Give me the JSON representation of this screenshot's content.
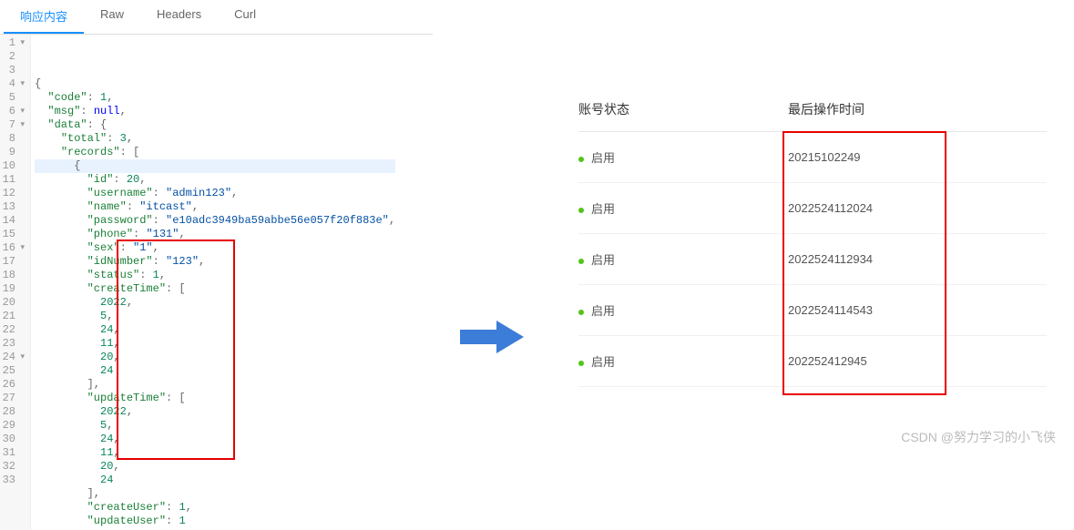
{
  "tabs": {
    "t0": "响应内容",
    "t1": "Raw",
    "t2": "Headers",
    "t3": "Curl"
  },
  "json_content": {
    "code": 1,
    "msg": null,
    "data": {
      "total": 3,
      "records": [
        {
          "id": 20,
          "username": "admin123",
          "name": "itcast",
          "password": "e10adc3949ba59abbe56e057f20f883e",
          "phone": "131",
          "sex": "1",
          "idNumber": "123",
          "status": 1,
          "createTime": [
            2022,
            5,
            24,
            11,
            20,
            24
          ],
          "updateTime": [
            2022,
            5,
            24,
            11,
            20,
            24
          ],
          "createUser": 1,
          "updateUser": 1
        }
      ]
    }
  },
  "code_lines": [
    {
      "n": "1",
      "fold": "▾",
      "indent": 0,
      "tokens": [
        {
          "t": "{",
          "c": "s-punc"
        }
      ]
    },
    {
      "n": "2",
      "indent": 1,
      "tokens": [
        {
          "t": "\"code\"",
          "c": "s-key"
        },
        {
          "t": ": ",
          "c": "s-punc"
        },
        {
          "t": "1",
          "c": "s-num"
        },
        {
          "t": ",",
          "c": "s-punc"
        }
      ]
    },
    {
      "n": "3",
      "indent": 1,
      "tokens": [
        {
          "t": "\"msg\"",
          "c": "s-key"
        },
        {
          "t": ": ",
          "c": "s-punc"
        },
        {
          "t": "null",
          "c": "s-kw"
        },
        {
          "t": ",",
          "c": "s-punc"
        }
      ]
    },
    {
      "n": "4",
      "fold": "▾",
      "indent": 1,
      "tokens": [
        {
          "t": "\"data\"",
          "c": "s-key"
        },
        {
          "t": ": {",
          "c": "s-punc"
        }
      ]
    },
    {
      "n": "5",
      "indent": 2,
      "tokens": [
        {
          "t": "\"total\"",
          "c": "s-key"
        },
        {
          "t": ": ",
          "c": "s-punc"
        },
        {
          "t": "3",
          "c": "s-num"
        },
        {
          "t": ",",
          "c": "s-punc"
        }
      ]
    },
    {
      "n": "6",
      "fold": "▾",
      "indent": 2,
      "tokens": [
        {
          "t": "\"records\"",
          "c": "s-key"
        },
        {
          "t": ": [",
          "c": "s-punc"
        }
      ]
    },
    {
      "n": "7",
      "fold": "▾",
      "hl": true,
      "indent": 3,
      "tokens": [
        {
          "t": "{",
          "c": "s-punc"
        }
      ]
    },
    {
      "n": "8",
      "indent": 4,
      "tokens": [
        {
          "t": "\"id\"",
          "c": "s-key"
        },
        {
          "t": ": ",
          "c": "s-punc"
        },
        {
          "t": "20",
          "c": "s-num"
        },
        {
          "t": ",",
          "c": "s-punc"
        }
      ]
    },
    {
      "n": "9",
      "indent": 4,
      "tokens": [
        {
          "t": "\"username\"",
          "c": "s-key"
        },
        {
          "t": ": ",
          "c": "s-punc"
        },
        {
          "t": "\"admin123\"",
          "c": "s-str"
        },
        {
          "t": ",",
          "c": "s-punc"
        }
      ]
    },
    {
      "n": "10",
      "indent": 4,
      "tokens": [
        {
          "t": "\"name\"",
          "c": "s-key"
        },
        {
          "t": ": ",
          "c": "s-punc"
        },
        {
          "t": "\"itcast\"",
          "c": "s-str"
        },
        {
          "t": ",",
          "c": "s-punc"
        }
      ]
    },
    {
      "n": "11",
      "indent": 4,
      "tokens": [
        {
          "t": "\"password\"",
          "c": "s-key"
        },
        {
          "t": ": ",
          "c": "s-punc"
        },
        {
          "t": "\"e10adc3949ba59abbe56e057f20f883e\"",
          "c": "s-str"
        },
        {
          "t": ",",
          "c": "s-punc"
        }
      ]
    },
    {
      "n": "12",
      "indent": 4,
      "tokens": [
        {
          "t": "\"phone\"",
          "c": "s-key"
        },
        {
          "t": ": ",
          "c": "s-punc"
        },
        {
          "t": "\"131\"",
          "c": "s-str"
        },
        {
          "t": ",",
          "c": "s-punc"
        }
      ]
    },
    {
      "n": "13",
      "indent": 4,
      "tokens": [
        {
          "t": "\"sex\"",
          "c": "s-key"
        },
        {
          "t": ": ",
          "c": "s-punc"
        },
        {
          "t": "\"1\"",
          "c": "s-str"
        },
        {
          "t": ",",
          "c": "s-punc"
        }
      ]
    },
    {
      "n": "14",
      "indent": 4,
      "tokens": [
        {
          "t": "\"idNumber\"",
          "c": "s-key"
        },
        {
          "t": ": ",
          "c": "s-punc"
        },
        {
          "t": "\"123\"",
          "c": "s-str"
        },
        {
          "t": ",",
          "c": "s-punc"
        }
      ]
    },
    {
      "n": "15",
      "indent": 4,
      "tokens": [
        {
          "t": "\"status\"",
          "c": "s-key"
        },
        {
          "t": ": ",
          "c": "s-punc"
        },
        {
          "t": "1",
          "c": "s-num"
        },
        {
          "t": ",",
          "c": "s-punc"
        }
      ]
    },
    {
      "n": "16",
      "fold": "▾",
      "indent": 4,
      "tokens": [
        {
          "t": "\"createTime\"",
          "c": "s-key"
        },
        {
          "t": ": [",
          "c": "s-punc"
        }
      ]
    },
    {
      "n": "17",
      "indent": 5,
      "tokens": [
        {
          "t": "2022",
          "c": "s-num"
        },
        {
          "t": ",",
          "c": "s-punc"
        }
      ]
    },
    {
      "n": "18",
      "indent": 5,
      "tokens": [
        {
          "t": "5",
          "c": "s-num"
        },
        {
          "t": ",",
          "c": "s-punc"
        }
      ]
    },
    {
      "n": "19",
      "indent": 5,
      "tokens": [
        {
          "t": "24",
          "c": "s-num"
        },
        {
          "t": ",",
          "c": "s-punc"
        }
      ]
    },
    {
      "n": "20",
      "indent": 5,
      "tokens": [
        {
          "t": "11",
          "c": "s-num"
        },
        {
          "t": ",",
          "c": "s-punc"
        }
      ]
    },
    {
      "n": "21",
      "indent": 5,
      "tokens": [
        {
          "t": "20",
          "c": "s-num"
        },
        {
          "t": ",",
          "c": "s-punc"
        }
      ]
    },
    {
      "n": "22",
      "indent": 5,
      "tokens": [
        {
          "t": "24",
          "c": "s-num"
        }
      ]
    },
    {
      "n": "23",
      "indent": 4,
      "tokens": [
        {
          "t": "],",
          "c": "s-punc"
        }
      ]
    },
    {
      "n": "24",
      "fold": "▾",
      "indent": 4,
      "tokens": [
        {
          "t": "\"updateTime\"",
          "c": "s-key"
        },
        {
          "t": ": [",
          "c": "s-punc"
        }
      ]
    },
    {
      "n": "25",
      "indent": 5,
      "tokens": [
        {
          "t": "2022",
          "c": "s-num"
        },
        {
          "t": ",",
          "c": "s-punc"
        }
      ]
    },
    {
      "n": "26",
      "indent": 5,
      "tokens": [
        {
          "t": "5",
          "c": "s-num"
        },
        {
          "t": ",",
          "c": "s-punc"
        }
      ]
    },
    {
      "n": "27",
      "indent": 5,
      "tokens": [
        {
          "t": "24",
          "c": "s-num"
        },
        {
          "t": ",",
          "c": "s-punc"
        }
      ]
    },
    {
      "n": "28",
      "indent": 5,
      "tokens": [
        {
          "t": "11",
          "c": "s-num"
        },
        {
          "t": ",",
          "c": "s-punc"
        }
      ]
    },
    {
      "n": "29",
      "indent": 5,
      "tokens": [
        {
          "t": "20",
          "c": "s-num"
        },
        {
          "t": ",",
          "c": "s-punc"
        }
      ]
    },
    {
      "n": "30",
      "indent": 5,
      "tokens": [
        {
          "t": "24",
          "c": "s-num"
        }
      ]
    },
    {
      "n": "31",
      "indent": 4,
      "tokens": [
        {
          "t": "],",
          "c": "s-punc"
        }
      ]
    },
    {
      "n": "32",
      "indent": 4,
      "tokens": [
        {
          "t": "\"createUser\"",
          "c": "s-key"
        },
        {
          "t": ": ",
          "c": "s-punc"
        },
        {
          "t": "1",
          "c": "s-num"
        },
        {
          "t": ",",
          "c": "s-punc"
        }
      ]
    },
    {
      "n": "33",
      "indent": 4,
      "tokens": [
        {
          "t": "\"updateUser\"",
          "c": "s-key"
        },
        {
          "t": ": ",
          "c": "s-punc"
        },
        {
          "t": "1",
          "c": "s-num"
        }
      ]
    }
  ],
  "table": {
    "headers": {
      "status": "账号状态",
      "time": "最后操作时间"
    },
    "rows": [
      {
        "status": "启用",
        "time": "20215102249"
      },
      {
        "status": "启用",
        "time": "2022524112024"
      },
      {
        "status": "启用",
        "time": "2022524112934"
      },
      {
        "status": "启用",
        "time": "2022524114543"
      },
      {
        "status": "启用",
        "time": "202252412945"
      }
    ]
  },
  "watermark": "CSDN @努力学习的小飞侠"
}
